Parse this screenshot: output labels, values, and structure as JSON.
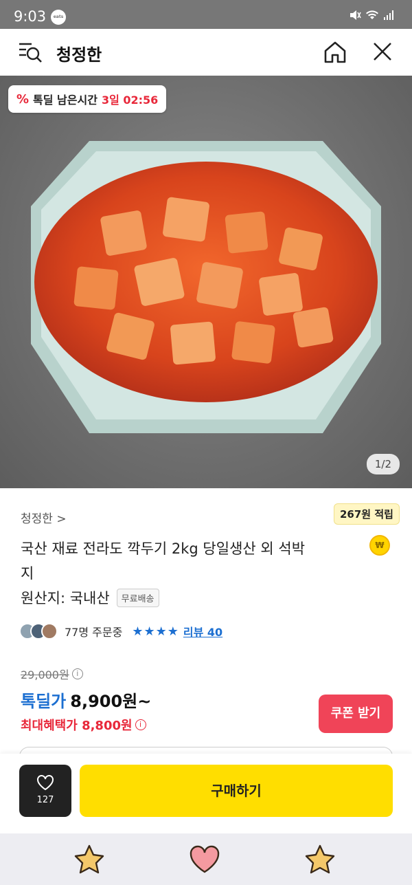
{
  "status_bar": {
    "time": "9:03",
    "app_badge": "eats"
  },
  "app_bar": {
    "title": "청정한"
  },
  "hero": {
    "deal_badge_label": "톡딜 남은시간",
    "deal_badge_timer": "3일 02:56",
    "page_indicator": "1/2"
  },
  "product": {
    "seller": "청정한 >",
    "points": "267원 적립",
    "coin_symbol": "₩",
    "title": "국산 재료 전라도 깍두기 2kg 당일생산 외 석박지",
    "origin": "원산지: 국내산",
    "free_shipping": "무료배송",
    "orders": "77명 주문중",
    "stars": "★★★★",
    "rating": 4,
    "review_link": "리뷰 40"
  },
  "price": {
    "original": "29,000원",
    "deal_label": "톡딜가",
    "deal_price": "8,900원~",
    "max_benefit": "최대혜택가 8,800원",
    "info_symbol": "i"
  },
  "buttons": {
    "coupon": "쿠폰 받기",
    "wish_count": "127",
    "buy": "구매하기"
  },
  "colors": {
    "accent_blue": "#1c6fd1",
    "accent_red": "#e8283a",
    "buy_yellow": "#ffde00",
    "coupon_red": "#f04458"
  }
}
